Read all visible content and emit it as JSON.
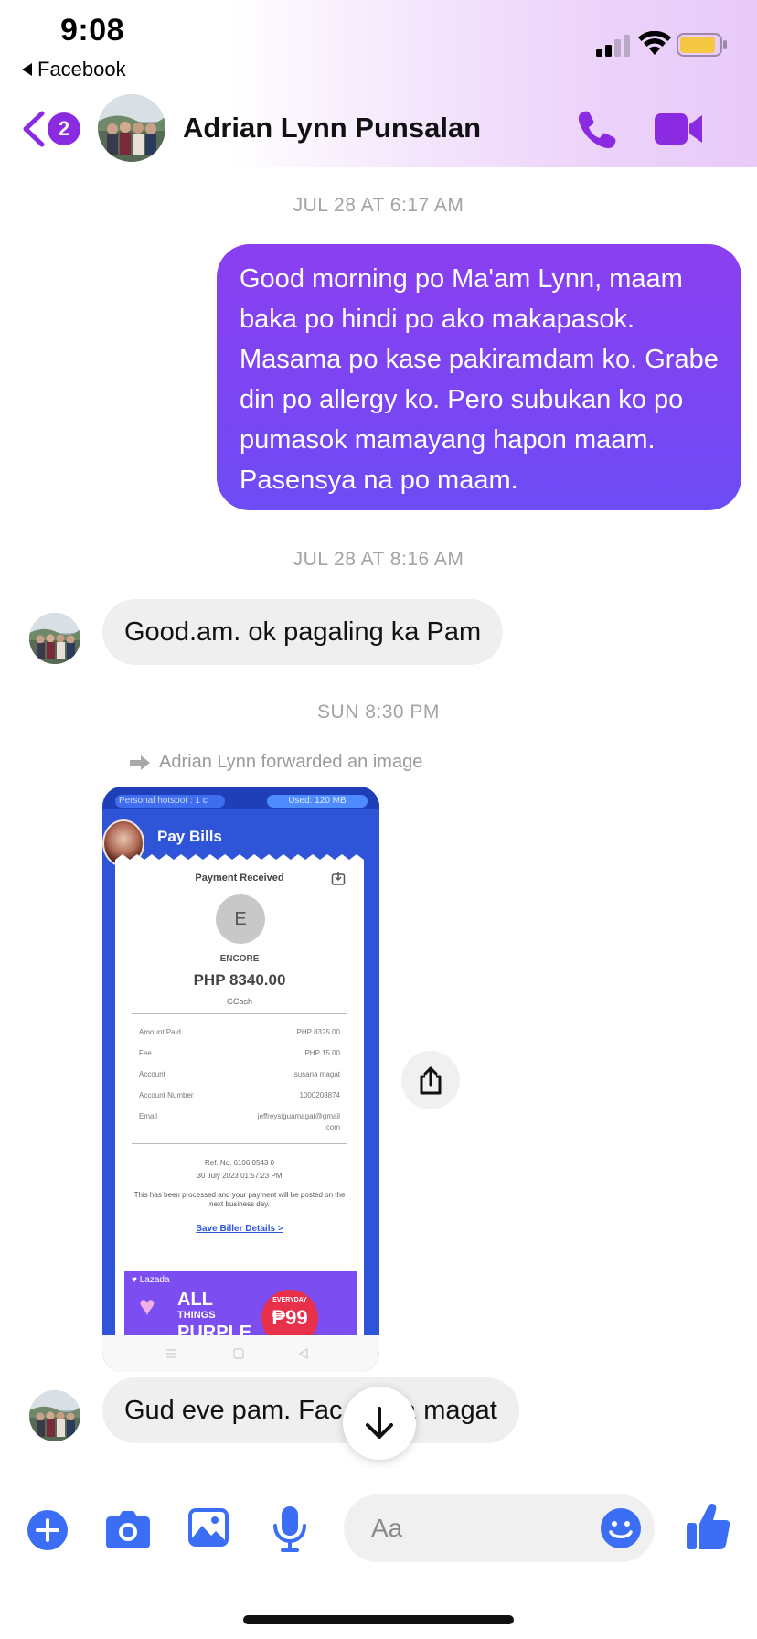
{
  "status_bar": {
    "time": "9:08",
    "back_app_label": "Facebook"
  },
  "header": {
    "unread_count": "2",
    "contact_name": "Adrian Lynn Punsalan",
    "accent_color": "#8a2be2"
  },
  "messages": {
    "timestamp_1": "JUL 28 AT 6:17 AM",
    "outgoing_1": "Good morning po Ma'am Lynn, maam baka po hindi po ako makapasok. Masama po kase pakiramdam ko. Grabe din po allergy ko. Pero subukan ko po pumasok mamayang hapon maam. Pasensya na po maam.",
    "timestamp_2": "JUL 28 AT 8:16 AM",
    "incoming_1": "Good.am. ok pagaling ka Pam",
    "timestamp_3": "SUN 8:30 PM",
    "forward_note": "Adrian Lynn forwarded an image",
    "incoming_2": "Gud eve pam. Fac      na magat"
  },
  "forwarded_image": {
    "status_left": "Personal hotspot : 1 c",
    "status_right": "Used: 120 MB",
    "title": "Pay Bills",
    "card_title": "Payment Received",
    "merchant_initial": "E",
    "merchant_name": "ENCORE",
    "amount": "PHP 8340.00",
    "method": "GCash",
    "rows": [
      {
        "label": "Amount Paid",
        "value": "PHP 8325.00"
      },
      {
        "label": "Fee",
        "value": "PHP 15.00"
      },
      {
        "label": "Account",
        "value": "susana magat"
      },
      {
        "label": "Account Number",
        "value": "1000208874"
      },
      {
        "label": "Email",
        "value": "jeffreysiguamagat@gmail"
      }
    ],
    "email_cont": ".com",
    "ref_no": "Ref. No. 6106 0543 0",
    "date": "30 July 2023 01:57:23 PM",
    "note": "This has been processed and your payment will be posted on the next business day.",
    "save_link": "Save Biller Details >",
    "promo_brand": "Lazada",
    "promo_line1": "ALL",
    "promo_line2": "THINGS",
    "promo_line3": "PURPLE",
    "promo_everyday": "EVERYDAY",
    "promo_price": "₱99"
  },
  "composer": {
    "placeholder": "Aa",
    "icon_color": "#3b6ef5"
  },
  "icons": [
    "back-chevron-icon",
    "phone-icon",
    "video-camera-icon",
    "share-icon",
    "arrow-down-icon",
    "plus-icon",
    "camera-icon",
    "gallery-icon",
    "microphone-icon",
    "emoji-icon",
    "thumbs-up-icon"
  ]
}
